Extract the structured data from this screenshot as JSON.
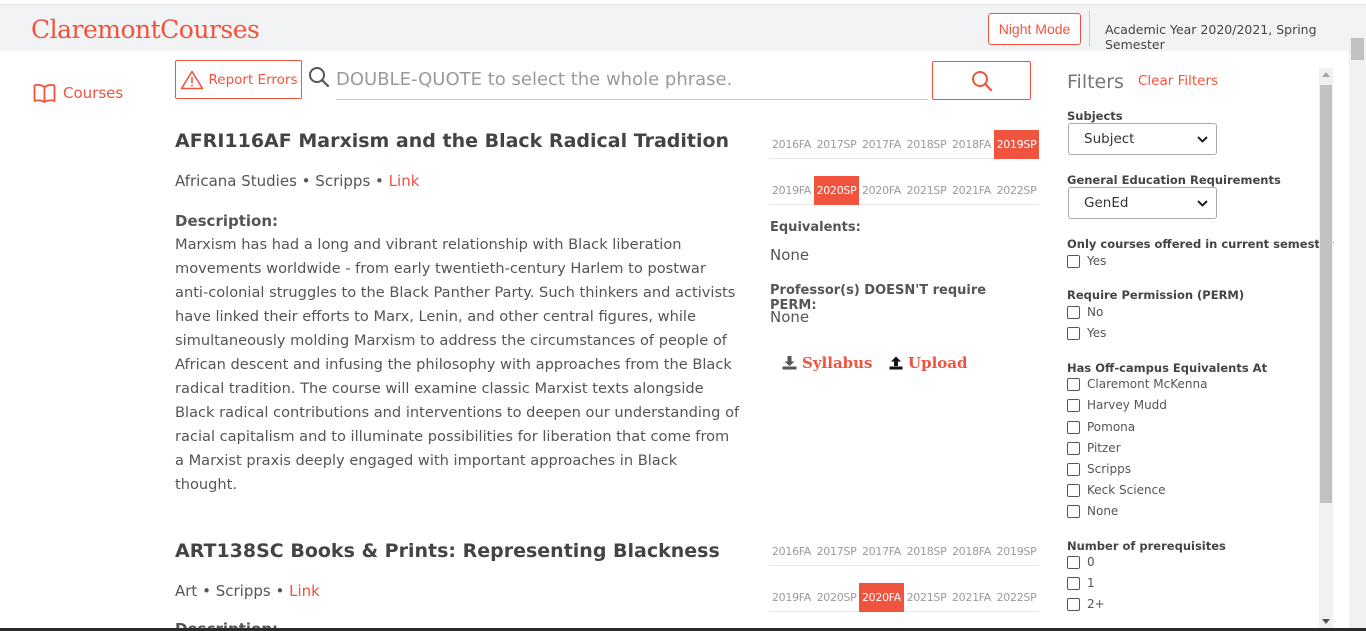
{
  "header": {
    "brand": "ClaremontCourses",
    "night_mode_label": "Night Mode",
    "academic_year": "Academic Year 2020/2021, Spring Semester"
  },
  "nav": {
    "courses_label": "Courses"
  },
  "toolbar": {
    "report_errors_label": "Report Errors",
    "search_placeholder": "DOUBLE-QUOTE to select the whole phrase."
  },
  "courses": [
    {
      "title": "AFRI116AF Marxism and the Black Radical Tradition",
      "department": "Africana Studies",
      "school": "Scripps",
      "link_label": "Link",
      "description_label": "Description:",
      "description": "Marxism has had a long and vibrant relationship with Black liberation movements worldwide - from early twentieth-century Harlem to postwar anti-colonial struggles to the Black Panther Party. Such thinkers and activists have linked their efforts to Marx, Lenin, and other central figures, while simultaneously molding Marxism to address the circumstances of people of African descent and infusing the philosophy with approaches from the Black radical tradition. The course will examine classic Marxist texts alongside Black radical contributions and interventions to deepen our understanding of racial capitalism and to illuminate possibilities for liberation that come from a Marxist praxis deeply engaged with important approaches in Black thought.",
      "semesters": [
        {
          "label": "2016FA",
          "active": false
        },
        {
          "label": "2017SP",
          "active": false
        },
        {
          "label": "2017FA",
          "active": false
        },
        {
          "label": "2018SP",
          "active": false
        },
        {
          "label": "2018FA",
          "active": false
        },
        {
          "label": "2019SP",
          "active": true
        },
        {
          "label": "2019FA",
          "active": false
        },
        {
          "label": "2020SP",
          "active": true
        },
        {
          "label": "2020FA",
          "active": false
        },
        {
          "label": "2021SP",
          "active": false
        },
        {
          "label": "2021FA",
          "active": false
        },
        {
          "label": "2022SP",
          "active": false
        }
      ],
      "equivalents_label": "Equivalents:",
      "equivalents_value": "None",
      "perm_label": "Professor(s) DOESN'T require PERM:",
      "perm_value": "None",
      "syllabus_label": "Syllabus",
      "upload_label": "Upload"
    },
    {
      "title": "ART138SC Books & Prints: Representing Blackness",
      "department": "Art",
      "school": "Scripps",
      "link_label": "Link",
      "description_label": "Description:",
      "semesters": [
        {
          "label": "2016FA",
          "active": false
        },
        {
          "label": "2017SP",
          "active": false
        },
        {
          "label": "2017FA",
          "active": false
        },
        {
          "label": "2018SP",
          "active": false
        },
        {
          "label": "2018FA",
          "active": false
        },
        {
          "label": "2019SP",
          "active": false
        },
        {
          "label": "2019FA",
          "active": false
        },
        {
          "label": "2020SP",
          "active": false
        },
        {
          "label": "2020FA",
          "active": true
        },
        {
          "label": "2021SP",
          "active": false
        },
        {
          "label": "2021FA",
          "active": false
        },
        {
          "label": "2022SP",
          "active": false
        }
      ]
    }
  ],
  "filters": {
    "title": "Filters",
    "clear_label": "Clear Filters",
    "subjects_label": "Subjects",
    "subjects_value": "Subject",
    "gened_label": "General Education Requirements",
    "gened_value": "GenEd",
    "current_label": "Only courses offered in current semester",
    "current_options": [
      "Yes"
    ],
    "perm_label": "Require Permission (PERM)",
    "perm_options": [
      "No",
      "Yes"
    ],
    "offcampus_label": "Has Off-campus Equivalents At",
    "offcampus_options": [
      "Claremont McKenna",
      "Harvey Mudd",
      "Pomona",
      "Pitzer",
      "Scripps",
      "Keck Science",
      "None"
    ],
    "prereq_label": "Number of prerequisites",
    "prereq_options": [
      "0",
      "1",
      "2+"
    ]
  },
  "colors": {
    "accent": "#f0533e",
    "text": "#555555",
    "topbar": "#f2f3f5"
  }
}
